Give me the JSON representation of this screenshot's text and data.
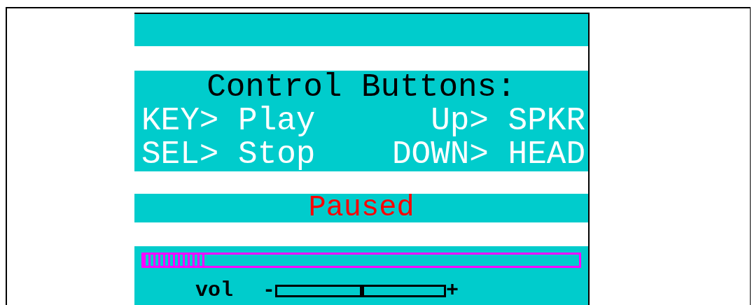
{
  "screen": {
    "title": "Control Buttons:",
    "controls": [
      {
        "left": "KEY> Play",
        "right": "Up> SPKR"
      },
      {
        "left": "SEL> Stop",
        "right": "DOWN> HEAD"
      }
    ],
    "status": "Paused",
    "progress": {
      "level": 0.14
    },
    "volume": {
      "label": "vol",
      "minus": "-",
      "plus": "+",
      "level": 0.51
    }
  }
}
